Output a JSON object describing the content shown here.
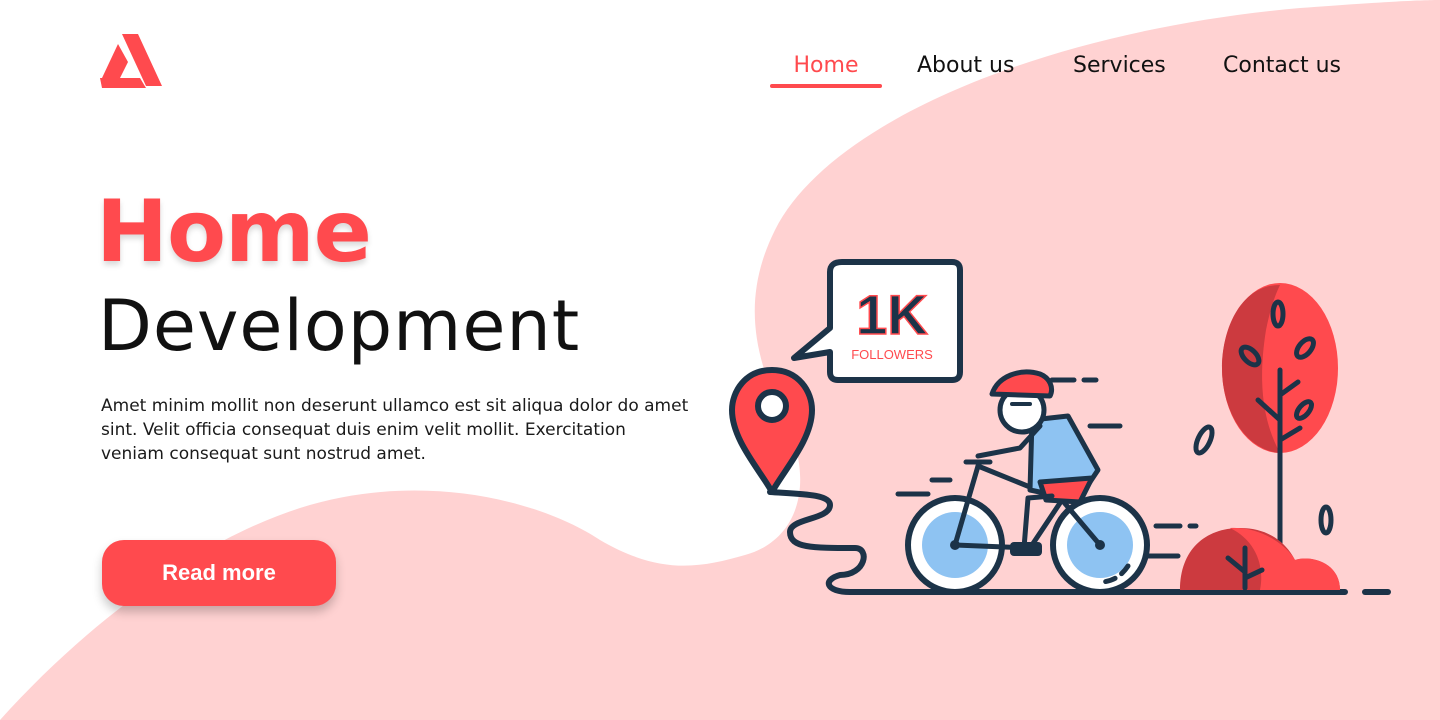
{
  "colors": {
    "accent": "#ff4a4e",
    "blob": "#ffd2d2",
    "dark": "#1c3348",
    "blue": "#8ec3f2",
    "tree_dark": "#cc3a3f",
    "text": "#111111"
  },
  "logo": {
    "icon": "triangle-a-logo"
  },
  "nav": {
    "items": [
      {
        "label": "Home",
        "active": true
      },
      {
        "label": "About us",
        "active": false
      },
      {
        "label": "Services",
        "active": false
      },
      {
        "label": "Contact us",
        "active": false
      }
    ]
  },
  "hero": {
    "title": "Home",
    "subtitle": "Development",
    "text": "Amet minim mollit non deserunt ullamco est sit aliqua dolor do amet sint. Velit officia consequat duis enim velit mollit. Exercitation veniam consequat sunt nostrud amet.",
    "button_label": "Read more"
  },
  "illustration": {
    "bubble_count": "1K",
    "bubble_label": "FOLLOWERS"
  }
}
